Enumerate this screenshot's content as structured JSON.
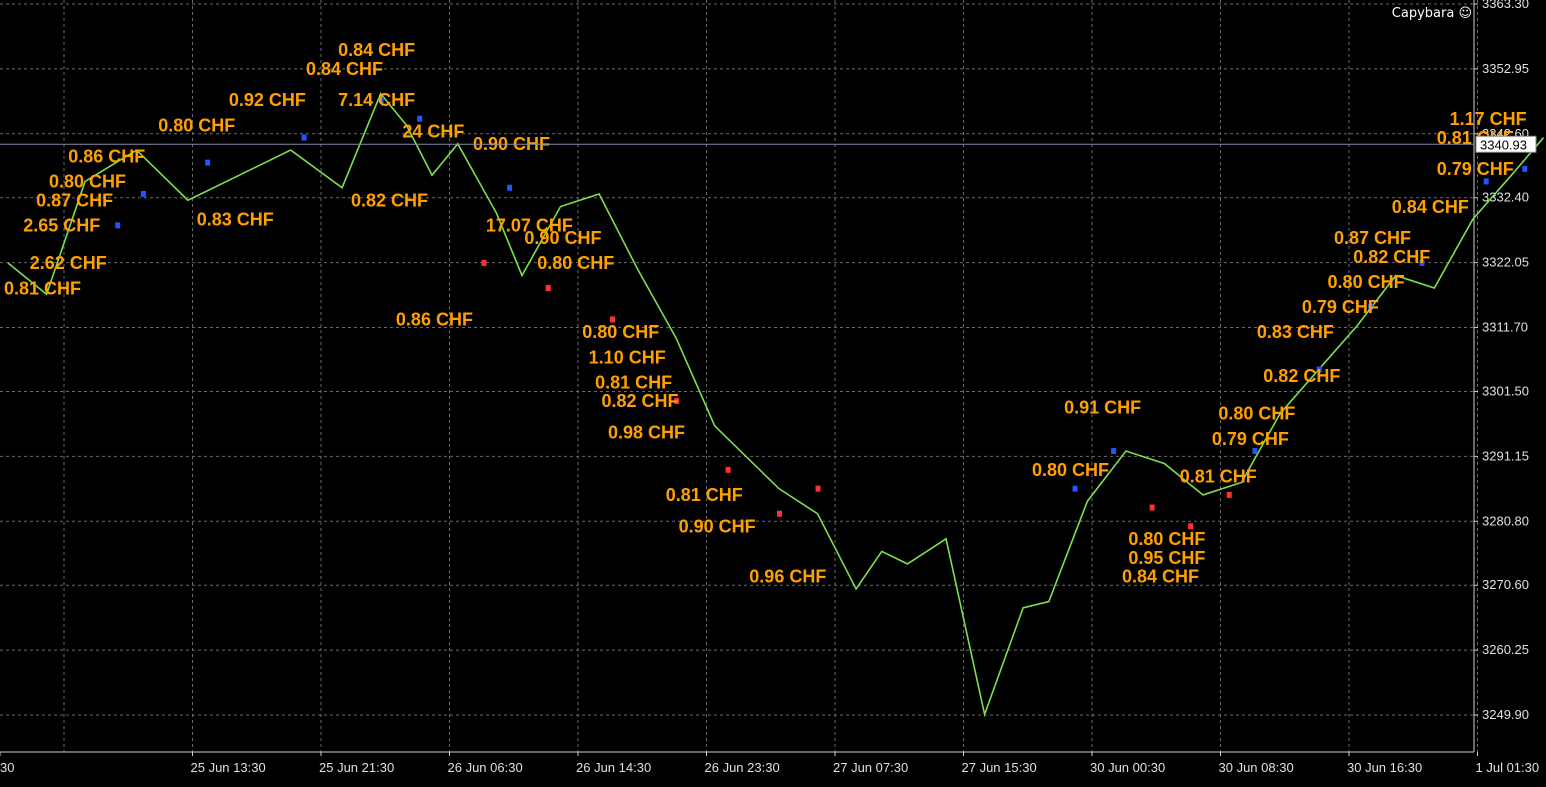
{
  "chart_data": {
    "type": "line",
    "symbol_watermark": "Capybara ☺",
    "current_price_label": "3340.93",
    "current_price": 3340.93,
    "ylim": [
      3244.0,
      3363.3
    ],
    "y_ticks": [
      "3363.30",
      "3352.95",
      "3342.60",
      "3332.40",
      "3322.05",
      "3311.70",
      "3301.50",
      "3291.15",
      "3280.80",
      "3270.60",
      "3260.25",
      "3249.90"
    ],
    "y_tick_values": [
      3363.3,
      3352.95,
      3342.6,
      3332.4,
      3322.05,
      3311.7,
      3301.5,
      3291.15,
      3280.8,
      3270.6,
      3260.25,
      3249.9
    ],
    "x_ticks": [
      "30",
      "25 Jun 13:30",
      "25 Jun 21:30",
      "26 Jun 06:30",
      "26 Jun 14:30",
      "26 Jun 23:30",
      "27 Jun 07:30",
      "27 Jun 15:30",
      "30 Jun 00:30",
      "30 Jun 08:30",
      "30 Jun 16:30",
      "1 Jul 01:30"
    ],
    "x_tick_index": [
      0,
      1,
      2,
      3,
      4,
      5,
      6,
      7,
      8,
      9,
      10,
      11
    ],
    "series": [
      {
        "color": "#7ddf4f",
        "x": [
          0,
          0.3,
          0.6,
          1.0,
          1.4,
          1.8,
          2.2,
          2.6,
          2.9,
          3.1,
          3.3,
          3.5,
          3.8,
          4.0,
          4.3,
          4.6,
          4.9,
          5.2,
          5.5,
          5.8,
          6.0,
          6.3,
          6.6,
          6.8,
          7.0,
          7.3,
          7.6,
          7.9,
          8.1,
          8.4,
          8.7,
          9.0,
          9.3,
          9.6,
          9.9,
          10.2,
          10.5,
          10.8,
          11.1,
          11.4,
          11.7,
          11.95
        ],
        "values": [
          3322,
          3317,
          3335,
          3340,
          3332,
          3336,
          3340,
          3334,
          3349,
          3344,
          3336,
          3341,
          3330,
          3320,
          3331,
          3333,
          3321,
          3310,
          3296,
          3290,
          3286,
          3282,
          3270,
          3276,
          3274,
          3278,
          3250,
          3267,
          3268,
          3284,
          3292,
          3290,
          3285,
          3287,
          3298,
          3305,
          3312,
          3320,
          3318,
          3329,
          3336,
          3342
        ]
      }
    ],
    "annotations": [
      {
        "text": "0.84 CHF",
        "x": 2.6,
        "y": 3355
      },
      {
        "text": "0.84 CHF",
        "x": 2.35,
        "y": 3352
      },
      {
        "text": "0.92 CHF",
        "x": 1.75,
        "y": 3347
      },
      {
        "text": "7.14 CHF",
        "x": 2.6,
        "y": 3347
      },
      {
        "text": "0.80 CHF",
        "x": 1.2,
        "y": 3343
      },
      {
        "text": "24 CHF",
        "x": 3.1,
        "y": 3342
      },
      {
        "text": "0.86 CHF",
        "x": 0.5,
        "y": 3338
      },
      {
        "text": "0.90 CHF",
        "x": 3.65,
        "y": 3340
      },
      {
        "text": "0.80 CHF",
        "x": 0.35,
        "y": 3334
      },
      {
        "text": "0.87 CHF",
        "x": 0.25,
        "y": 3331
      },
      {
        "text": "0.82 CHF",
        "x": 2.7,
        "y": 3331
      },
      {
        "text": "2.65 CHF",
        "x": 0.15,
        "y": 3327
      },
      {
        "text": "0.83 CHF",
        "x": 1.5,
        "y": 3328
      },
      {
        "text": "17.07 CHF",
        "x": 3.75,
        "y": 3327
      },
      {
        "text": "0.90 CHF",
        "x": 4.05,
        "y": 3325
      },
      {
        "text": "2.62 CHF",
        "x": 0.2,
        "y": 3321
      },
      {
        "text": "0.80 CHF",
        "x": 4.15,
        "y": 3321
      },
      {
        "text": "0.81 CHF",
        "x": 0.0,
        "y": 3317
      },
      {
        "text": "0.86 CHF",
        "x": 3.05,
        "y": 3312
      },
      {
        "text": "0.80 CHF",
        "x": 4.5,
        "y": 3310
      },
      {
        "text": "1.10 CHF",
        "x": 4.55,
        "y": 3306
      },
      {
        "text": "0.81 CHF",
        "x": 4.6,
        "y": 3302
      },
      {
        "text": "0.82 CHF",
        "x": 4.65,
        "y": 3299
      },
      {
        "text": "0.98 CHF",
        "x": 4.7,
        "y": 3294
      },
      {
        "text": "0.81 CHF",
        "x": 5.15,
        "y": 3284
      },
      {
        "text": "0.90 CHF",
        "x": 5.25,
        "y": 3279
      },
      {
        "text": "0.96 CHF",
        "x": 5.8,
        "y": 3271
      },
      {
        "text": "0.91 CHF",
        "x": 8.25,
        "y": 3298
      },
      {
        "text": "0.80 CHF",
        "x": 8.0,
        "y": 3288
      },
      {
        "text": "0.81 CHF",
        "x": 9.15,
        "y": 3287
      },
      {
        "text": "0.80 CHF",
        "x": 8.75,
        "y": 3277
      },
      {
        "text": "0.95 CHF",
        "x": 8.75,
        "y": 3274
      },
      {
        "text": "0.84 CHF",
        "x": 8.7,
        "y": 3271
      },
      {
        "text": "0.79 CHF",
        "x": 9.4,
        "y": 3293
      },
      {
        "text": "0.80 CHF",
        "x": 9.45,
        "y": 3297
      },
      {
        "text": "0.82 CHF",
        "x": 9.8,
        "y": 3303
      },
      {
        "text": "0.83 CHF",
        "x": 9.75,
        "y": 3310
      },
      {
        "text": "0.79 CHF",
        "x": 10.1,
        "y": 3314
      },
      {
        "text": "0.80 CHF",
        "x": 10.3,
        "y": 3318
      },
      {
        "text": "0.82 CHF",
        "x": 10.5,
        "y": 3322
      },
      {
        "text": "0.87 CHF",
        "x": 10.35,
        "y": 3325
      },
      {
        "text": "0.84 CHF",
        "x": 10.8,
        "y": 3330
      },
      {
        "text": "0.79 CHF",
        "x": 11.15,
        "y": 3336
      },
      {
        "text": "0.81 CHF",
        "x": 11.15,
        "y": 3341
      },
      {
        "text": "1.17 CHF",
        "x": 11.25,
        "y": 3344
      }
    ],
    "buy_markers": [
      [
        0.85,
        3328
      ],
      [
        1.05,
        3333
      ],
      [
        1.55,
        3338
      ],
      [
        2.3,
        3342
      ],
      [
        2.9,
        3348
      ],
      [
        3.2,
        3345
      ],
      [
        3.9,
        3334
      ],
      [
        8.3,
        3286
      ],
      [
        8.6,
        3292
      ],
      [
        9.7,
        3292
      ],
      [
        10.2,
        3305
      ],
      [
        10.6,
        3315
      ],
      [
        11.0,
        3322
      ],
      [
        11.5,
        3335
      ],
      [
        11.8,
        3337
      ]
    ],
    "sell_markers": [
      [
        3.7,
        3322
      ],
      [
        4.2,
        3318
      ],
      [
        4.7,
        3313
      ],
      [
        5.2,
        3300
      ],
      [
        5.6,
        3289
      ],
      [
        6.0,
        3282
      ],
      [
        6.3,
        3286
      ],
      [
        8.9,
        3283
      ],
      [
        9.2,
        3280
      ],
      [
        9.5,
        3285
      ]
    ],
    "grid": true,
    "background": "#000000",
    "annotation_color": "#ffa000"
  }
}
